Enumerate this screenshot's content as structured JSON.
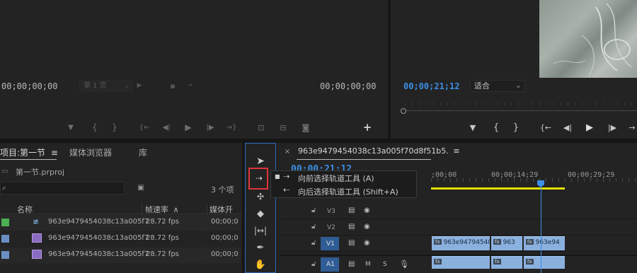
{
  "source_monitor": {
    "timecode_left": "00;00;00;00",
    "page_select": "第 1 页",
    "timecode_right": "00;00;00;00"
  },
  "program_monitor": {
    "timecode": "00;00;21;12",
    "fit_select": "适合"
  },
  "project_panel": {
    "tabs": [
      "项目:第一节",
      "媒体浏览器",
      "库"
    ],
    "project_file": "第一节.prproj",
    "item_count": "3 个项",
    "columns": [
      "名称",
      "帧速率",
      "媒体开"
    ],
    "items": [
      {
        "name": "963e9479454038c13a005f7",
        "fps": "28.72 fps",
        "media_start": "00;00;0",
        "color": "#4caf50"
      },
      {
        "name": "963e9479454038c13a005f7",
        "fps": "28.72 fps",
        "media_start": "00;00;0",
        "color": "#6a8fc4"
      },
      {
        "name": "963e9479454038c13a005f7",
        "fps": "28.72 fps",
        "media_start": "00;00;0",
        "color": "#6a8fc4"
      }
    ]
  },
  "timeline": {
    "sequence_tab": "963e9479454038c13a005f70d8f51b5.",
    "timecode": "00;00;21;12",
    "ruler_labels": [
      ";00;00",
      "00;00;14;29",
      "00;00;29;29"
    ],
    "tracks": [
      {
        "label": "V3"
      },
      {
        "label": "V2"
      },
      {
        "label": "V1"
      },
      {
        "label": "A1",
        "m": "M",
        "s": "S"
      }
    ],
    "clips": [
      {
        "label": "963e94794540"
      },
      {
        "label": "963"
      },
      {
        "label": "963e94"
      }
    ]
  },
  "tooltip": {
    "items": [
      {
        "label": "向前选择轨道工具 (A)"
      },
      {
        "label": "向后选择轨道工具 (Shift+A)"
      }
    ]
  },
  "colors": {
    "accent": "#3b8fe6",
    "highlight_box": "#e0343a",
    "clip": "#8ab0de",
    "work_area": "#e6e000"
  }
}
